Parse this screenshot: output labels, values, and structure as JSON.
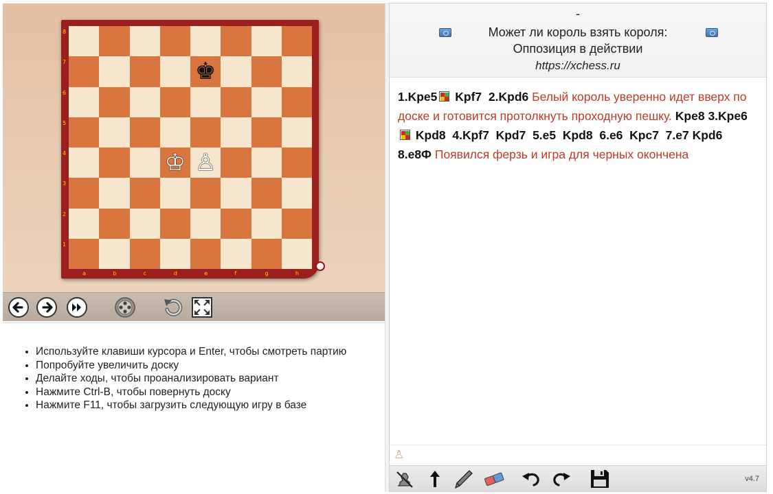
{
  "board": {
    "files": [
      "a",
      "b",
      "c",
      "d",
      "e",
      "f",
      "g",
      "h"
    ],
    "ranks": [
      "8",
      "7",
      "6",
      "5",
      "4",
      "3",
      "2",
      "1"
    ],
    "colors": {
      "light": "#f6e6cd",
      "dark": "#d9753f",
      "frame": "#9c1f1f",
      "coords": "#ffd200"
    },
    "pieces": [
      {
        "name": "black-king",
        "square": "e7",
        "glyph": "♚",
        "color": "black"
      },
      {
        "name": "white-king",
        "square": "d4",
        "glyph": "♔",
        "color": "white"
      },
      {
        "name": "white-pawn",
        "square": "e4",
        "glyph": "♙",
        "color": "white"
      }
    ]
  },
  "controls": {
    "icons": [
      "prev-move-icon",
      "next-move-icon",
      "last-move-icon",
      "new-board-icon",
      "flip-board-icon",
      "fullscreen-icon"
    ]
  },
  "tips": [
    "Используйте клавиши курсора и Enter, чтобы смотреть партию",
    "Попробуйте увеличить доску",
    "Делайте ходы, чтобы проанализировать вариант",
    "Нажмите Ctrl-B, чтобы повернуть доску",
    "Нажмите F11, чтобы загрузить следующую игру в базе"
  ],
  "header": {
    "dash": "-",
    "title": "Может ли король взять короля:",
    "subtitle": "Оппозиция в действии",
    "url": "https://xchess.ru"
  },
  "moves": {
    "m1": "1.Kpe5",
    "m2": "Kpf7",
    "m3": "2.Kpd6",
    "c1": "Белый король уверенно идет вверх по доске и готовится протолкнуть проходную пешку.",
    "m4": "Kpe8",
    "m5": "3.Kpe6",
    "m6": "Kpd8",
    "m7": "4.Kpf7",
    "m8": "Kpd7",
    "m9": "5.e5",
    "m10": "Kpd8",
    "m11": "6.e6",
    "m12": "Kpc7",
    "m13": "7.e7",
    "m14": "Kpd6",
    "m15": "8.e8Ф",
    "c2": "Появился ферзь и игра для черных окончена"
  },
  "toolbar": {
    "icons": [
      "delete-move-icon",
      "promote-variation-icon",
      "comment-pen-icon",
      "eraser-icon",
      "undo-icon",
      "redo-icon",
      "save-icon"
    ],
    "version": "v4.7"
  }
}
